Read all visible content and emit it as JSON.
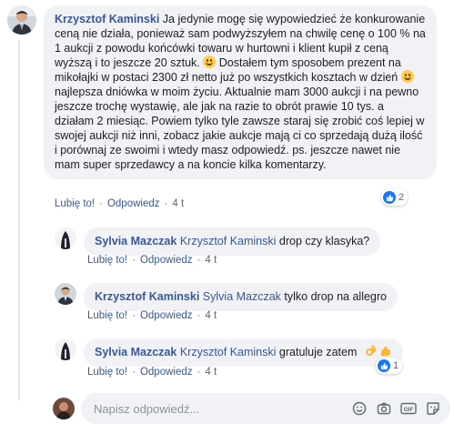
{
  "comments": [
    {
      "author": "Krzysztof Kaminski",
      "text_before_emoji": "Ja jedynie mogę się wypowiedzieć że konkurowanie ceną nie działa, ponieważ sam podwyższyłem na chwilę cenę o 100 % na 1 aukcji z powodu końcówki towaru w hurtowni i klient kupił z ceną wyższą i to jeszcze 20 sztuk. ",
      "text_middle": " Dostałem tym sposobem prezent na mikołajki w postaci 2300 zł netto już po wszystkich kosztach w dzień ",
      "text_after": " najlepsza dniówka w moim życiu. Aktualnie mam 3000 aukcji i na pewno jeszcze trochę wystawię, ale jak na razie to obrót prawie 10 tys. a działam 2 miesiąc. Powiem tylko tyle zawsze staraj się zrobić coś lepiej w swojej aukcji niż inni, zobacz jakie aukcje mają ci co sprzedają dużą ilość i porównaj ze swoimi i wtedy masz odpowiedź. ps. jeszcze nawet nie mam super sprzedawcy a na koncie kilka komentarzy.",
      "like_label": "Lubię to!",
      "reply_label": "Odpowiedz",
      "time": "4 t",
      "reaction_count": "2"
    }
  ],
  "replies": [
    {
      "author": "Sylvia Mazczak",
      "mention": "Krzysztof Kaminski",
      "text": "drop czy klasyka?",
      "like_label": "Lubię to!",
      "reply_label": "Odpowiedz",
      "time": "4 t"
    },
    {
      "author": "Krzysztof Kaminski",
      "mention": "Sylvia Mazczak",
      "text": "tylko drop na allegro",
      "like_label": "Lubię to!",
      "reply_label": "Odpowiedz",
      "time": "4 t"
    },
    {
      "author": "Sylvia Mazczak",
      "mention": "Krzysztof Kaminski",
      "text": "gratuluje zatem",
      "like_label": "Lubię to!",
      "reply_label": "Odpowiedz",
      "time": "4 t",
      "reaction_count": "1"
    }
  ],
  "reply_input": {
    "placeholder": "Napisz odpowiedź..."
  },
  "icons": {
    "emoji": "smiley-icon",
    "camera": "camera-icon",
    "gif": "gif-icon",
    "sticker": "sticker-icon"
  },
  "colors": {
    "link": "#385898",
    "bubble": "#f0f2f5",
    "like_blue": "#1877f2"
  }
}
